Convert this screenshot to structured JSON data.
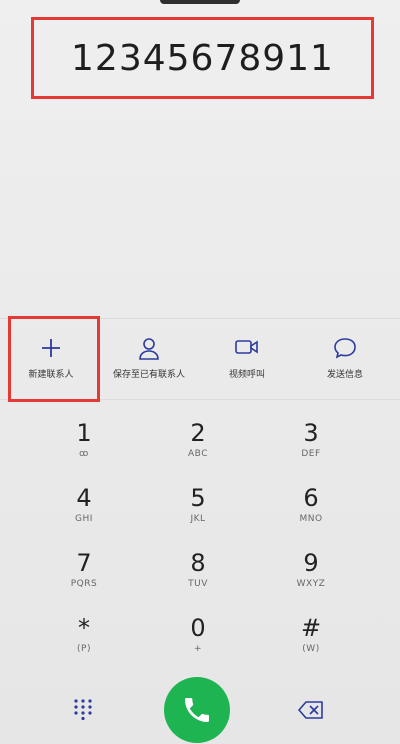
{
  "display": {
    "number": "12345678911"
  },
  "actions": [
    {
      "label": "新建联系人",
      "icon": "plus-icon"
    },
    {
      "label": "保存至已有联系人",
      "icon": "person-icon"
    },
    {
      "label": "视频呼叫",
      "icon": "video-camera-icon"
    },
    {
      "label": "发送信息",
      "icon": "message-bubble-icon"
    }
  ],
  "keypad": [
    {
      "digit": "1",
      "sub": "ꝏ"
    },
    {
      "digit": "2",
      "sub": "ABC"
    },
    {
      "digit": "3",
      "sub": "DEF"
    },
    {
      "digit": "4",
      "sub": "GHI"
    },
    {
      "digit": "5",
      "sub": "JKL"
    },
    {
      "digit": "6",
      "sub": "MNO"
    },
    {
      "digit": "7",
      "sub": "PQRS"
    },
    {
      "digit": "8",
      "sub": "TUV"
    },
    {
      "digit": "9",
      "sub": "WXYZ"
    },
    {
      "digit": "*",
      "sub": "(P)"
    },
    {
      "digit": "0",
      "sub": "+"
    },
    {
      "digit": "#",
      "sub": "(W)"
    }
  ],
  "bottom": {
    "dialpad_icon": "dialpad-grid-icon",
    "call_icon": "phone-icon",
    "delete_icon": "backspace-icon"
  },
  "colors": {
    "highlight": "#e53935",
    "call": "#1fb452",
    "accent": "#2d3a9e"
  }
}
